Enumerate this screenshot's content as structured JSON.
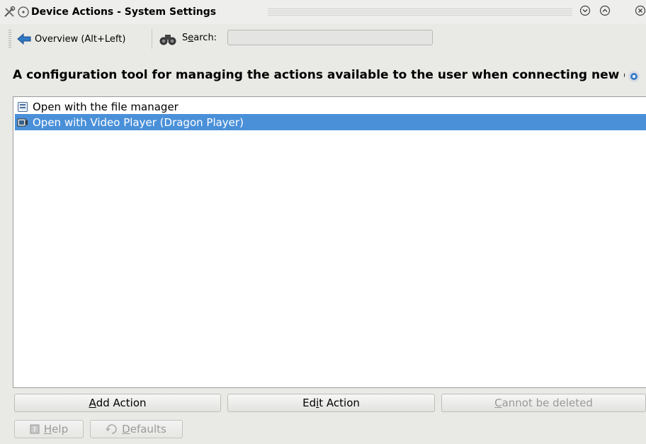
{
  "window": {
    "title": "Device Actions - System Settings",
    "icons": [
      "tools-icon",
      "sticky-icon",
      "minimize-icon",
      "maximize-icon",
      "close-icon"
    ]
  },
  "toolbar": {
    "back_label": "Overview (Alt+Left)",
    "search_label_pre": "S",
    "search_label_mnemonic": "e",
    "search_label_post": "arch:",
    "search_value": ""
  },
  "main": {
    "description": "A configuration tool for managing the actions available to the user when connecting new devices to the computer.",
    "actions": [
      {
        "label": "Open with the file manager",
        "icon": "file-manager-icon",
        "selected": false
      },
      {
        "label": "Open with Video Player (Dragon Player)",
        "icon": "video-player-icon",
        "selected": true
      }
    ]
  },
  "buttons": {
    "add": {
      "pre": "",
      "mn": "A",
      "post": "dd Action"
    },
    "edit": {
      "pre": "Ed",
      "mn": "i",
      "post": "t Action"
    },
    "delete": {
      "pre": "",
      "mn": "C",
      "post": "annot be deleted"
    }
  },
  "footer": {
    "help": {
      "pre": "",
      "mn": "H",
      "post": "elp"
    },
    "defaults": {
      "pre": "",
      "mn": "D",
      "post": "efaults"
    }
  },
  "colors": {
    "selection": "#4a90d9",
    "background": "#e9e9e6",
    "disabled_text": "#9a9a9a"
  }
}
